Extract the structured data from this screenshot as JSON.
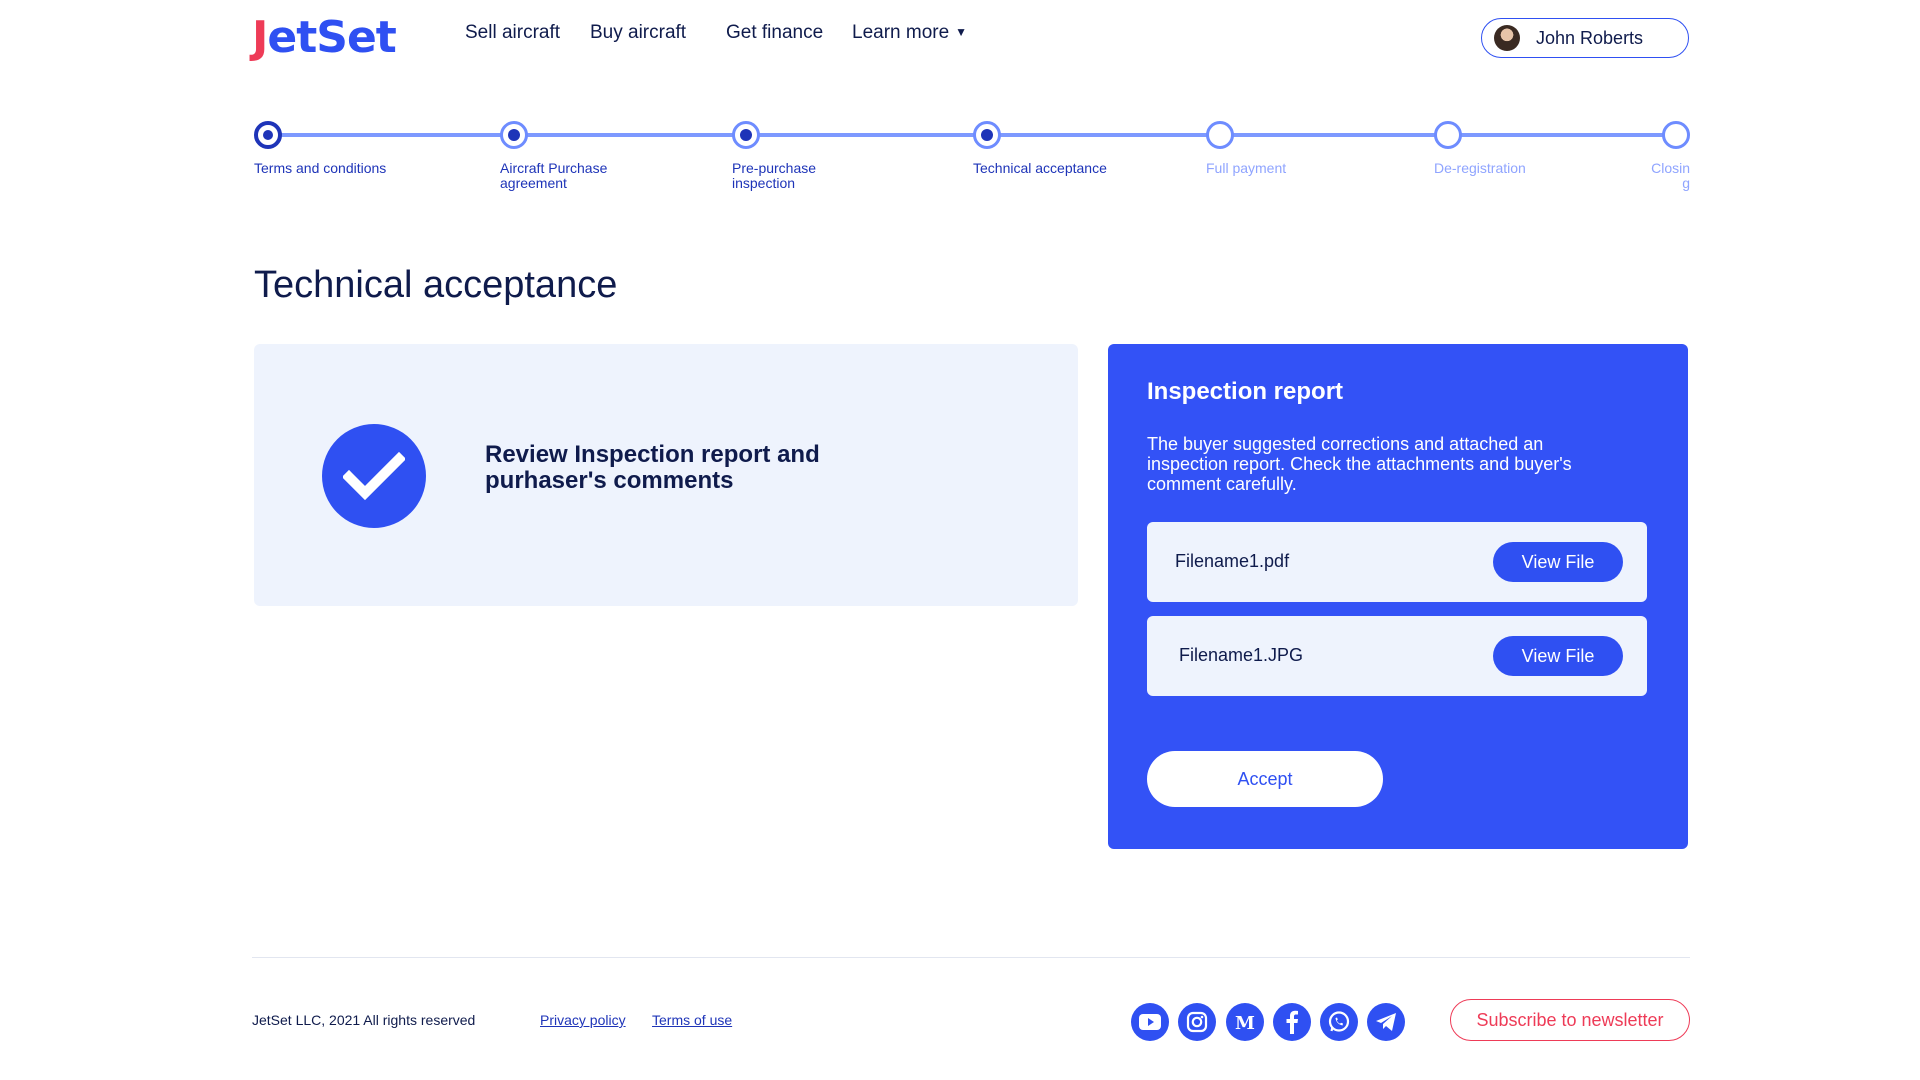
{
  "brand": {
    "logo_first": "J",
    "logo_rest": "etSet"
  },
  "nav": {
    "items": [
      "Sell aircraft",
      "Buy aircraft",
      "Get finance",
      "Learn more"
    ]
  },
  "user": {
    "name": "John Roberts"
  },
  "stepper": {
    "steps": [
      {
        "label": "Terms and conditions",
        "state": "current"
      },
      {
        "label": "Aircraft Purchase agreement",
        "state": "done"
      },
      {
        "label": "Pre-purchase inspection",
        "state": "done"
      },
      {
        "label": "Technical acceptance",
        "state": "done"
      },
      {
        "label": "Full payment",
        "state": "upcoming"
      },
      {
        "label": "De-registration",
        "state": "upcoming"
      },
      {
        "label": "Closin g",
        "state": "upcoming"
      }
    ]
  },
  "page": {
    "title": "Technical acceptance"
  },
  "review": {
    "text": "Review Inspection report and purhaser's comments"
  },
  "inspection": {
    "title": "Inspection report",
    "description": "The buyer suggested corrections and attached an inspection report. Check the attachments and buyer's comment carefully.",
    "files": [
      {
        "name": "Filename1.pdf",
        "button": "View File"
      },
      {
        "name": "Filename1.JPG",
        "button": "View File"
      }
    ],
    "accept_label": "Accept"
  },
  "footer": {
    "copyright": "JetSet LLC, 2021 All rights reserved",
    "privacy": "Privacy policy",
    "terms": "Terms of use",
    "socials": [
      "youtube-icon",
      "instagram-icon",
      "medium-icon",
      "facebook-icon",
      "whatsapp-icon",
      "telegram-icon"
    ],
    "subscribe": "Subscribe to newsletter"
  },
  "colors": {
    "primary": "#2f50f2",
    "navy": "#0f1b4c",
    "accent_red": "#ee3b57",
    "light_bg": "#eef3fd"
  }
}
